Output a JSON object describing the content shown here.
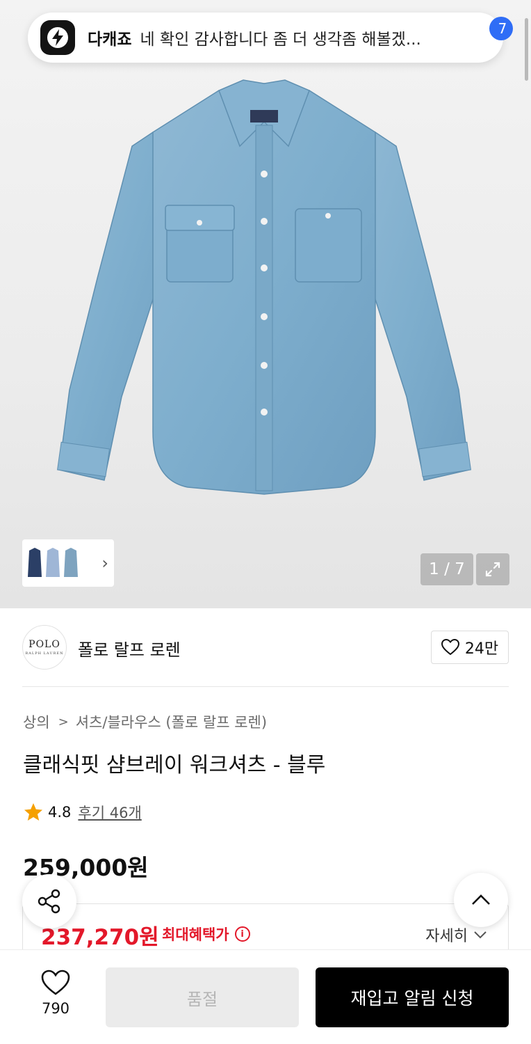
{
  "notification": {
    "app_name": "다캐죠",
    "message": "네 확인 감사합니다 좀 더 생각좀 해볼겠...",
    "badge": "7"
  },
  "gallery": {
    "counter": "1 / 7",
    "thumbnail_count": 3
  },
  "brand": {
    "logo_text": "POLO",
    "logo_subtext": "RALPH LAUREN",
    "name": "폴로 랄프 로렌",
    "likes": "24만"
  },
  "breadcrumb": {
    "level1": "상의",
    "separator": ">",
    "level2": "셔츠/블라우스 (폴로 랄프 로렌)"
  },
  "product": {
    "title": "클래식핏 샴브레이 워크셔츠 - 블루",
    "rating": "4.8",
    "reviews": "후기 46개",
    "price": "259,000원",
    "benefit_price": "237,270원",
    "benefit_label": "최대혜택가",
    "detail_link": "자세히"
  },
  "bottom_bar": {
    "wish_count": "790",
    "soldout_label": "품절",
    "restock_label": "재입고 알림 신청"
  },
  "colors": {
    "accent_red": "#e3182a",
    "badge_blue": "#2f6df6",
    "primary_black": "#000000",
    "star": "#f5a000"
  }
}
